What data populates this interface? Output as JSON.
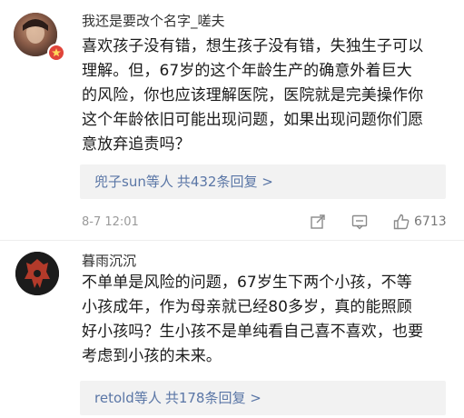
{
  "comments": [
    {
      "username": "我还是要改个名字_嗟夫",
      "lines": [
        "喜欢孩子没有错，想生孩子没有错，失独生子可以",
        "理解。但，67岁的这个年龄生产的确意外着巨大",
        "的风险，你也应该理解医院，医院就是完美操作你",
        "这个年龄依旧可能出现问题，如果出现问题你们愿",
        "意放弃追责吗？"
      ],
      "replies": {
        "user": "兜子sun等人",
        "count": "共432条回复 >"
      },
      "timestamp": "8-7 12:01",
      "like_count": "6713"
    },
    {
      "username": "暮雨沉沉",
      "lines": [
        "不单单是风险的问题，67岁生下两个小孩，不等",
        "小孩成年，作为母亲就已经80多岁，真的能照顾",
        "好小孩吗？生小孩不是单纯看自己喜不喜欢，也要",
        "考虑到小孩的未来。"
      ],
      "replies": {
        "user": "retold等人",
        "count": "共178条回复 >"
      }
    }
  ],
  "colors": {
    "link": "#5a76a6",
    "reply_bg": "#f2f2f2",
    "badge": "#e0443a"
  }
}
